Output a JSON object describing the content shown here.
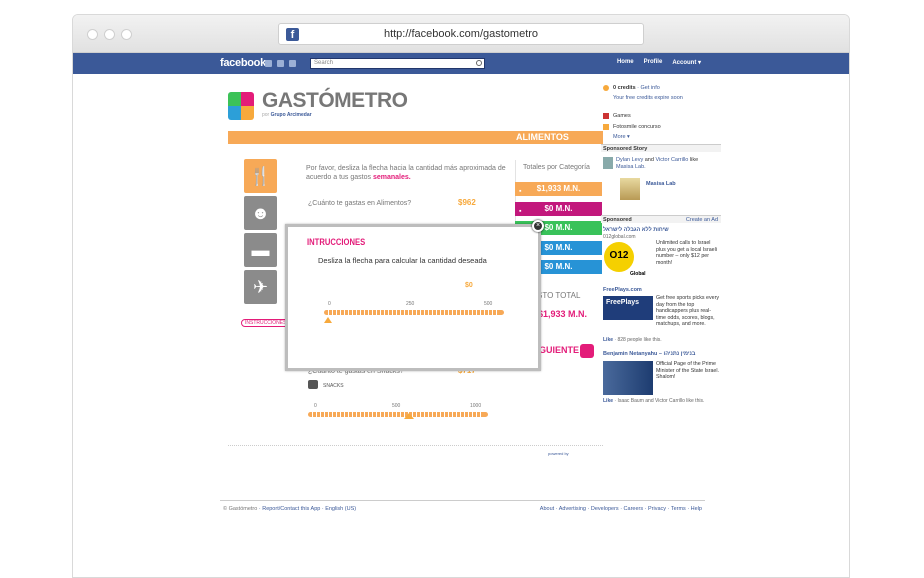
{
  "browser": {
    "url": "http://facebook.com/gastometro"
  },
  "fb": {
    "logo": "facebook",
    "search_placeholder": "Search",
    "nav": {
      "home": "Home",
      "profile": "Profile",
      "account": "Account ▾"
    }
  },
  "app": {
    "title": "GASTÓMETRO",
    "subtitle_prefix": "por",
    "subtitle_brand": "Grupo Arcimedar",
    "category": "ALIMENTOS",
    "description": "Por favor, desliza la flecha hacia la cantidad más aproximada de acuerdo a tus gastos",
    "description_bold": "semanales.",
    "instrucciones_link": "INSTRUCCIONES",
    "q1": "¿Cuánto te gastas en Alimentos?",
    "q1_amount": "$962",
    "q2": "¿Cuánto te gastas en Snacks?",
    "q2_amount": "$717",
    "snacks_label": "SNACKS",
    "snacks_ticks": [
      "0",
      "500",
      "1000"
    ],
    "snacks_value_fraction": 0.57,
    "totals_title": "Totales por Categoría",
    "totals": [
      {
        "value": "$1,933 M.N.",
        "color": "#f7a957"
      },
      {
        "value": "$0 M.N.",
        "color": "#c2187c"
      },
      {
        "value": "$0 M.N.",
        "color": "#39c25a"
      },
      {
        "value": "$0 M.N.",
        "color": "#2793d6"
      },
      {
        "value": "$0 M.N.",
        "color": "#2793d6"
      }
    ],
    "costo_label": "STO TOTAL",
    "costo_value": "$1,933 M.N.",
    "siguiente": "GUIENTE",
    "powered": "powered by"
  },
  "modal": {
    "title": "INTRUCCIONES",
    "text": "Desliza la flecha para calcular la cantidad deseada",
    "value": "$0",
    "ticks": [
      "0",
      "250",
      "500"
    ],
    "value_fraction": 0,
    "close": "×"
  },
  "footer": {
    "left": "© Gastómetro",
    "left_links": "· Report/Contact this App · English (US)",
    "right": "About · Advertising · Developers · Careers · Privacy · Terms · Help"
  },
  "sidebar": {
    "credits": "0 credits",
    "get_info": "· Get info",
    "free_credits": "Your free credits expire soon",
    "games": "Games",
    "fotosmile": "Fotosmile concurso",
    "more": "More ▾",
    "sponsored_story": "Sponsored Story",
    "story_text_a": "Dylan Levy",
    "story_text_b": " and ",
    "story_text_c": "Victor Carrillo",
    "story_text_d": " like",
    "story_page": "Masisa Lab.",
    "story_ad": "Masisa Lab",
    "sponsored": "Sponsored",
    "create_ad": "Create an Ad",
    "ad1_head": "שיחות ללא הגבלה לישראל",
    "ad1_site": "012global.com",
    "ad1_text": "Unlimited calls to Israel plus you get a local Israeli number – only $12 per month!",
    "ad1_logo": "O12",
    "ad1_logo2": "Global",
    "ad2_head": "FreePlays.com",
    "ad2_logo": "FreePlays",
    "ad2_text": "Get free sports picks every day from the top handicappers plus real-time odds, scores, blogs, matchups, and more.",
    "ad2_like": "· 828 people like this.",
    "ad3_head": "Benjamin Netanyahu – בנימין נתניהו",
    "ad3_text": "Official Page of the Prime Minister of the State Israel. Shalom!",
    "ad3_like": "· Isaac Baum and Victor Carrillo like this.",
    "like": "Like"
  }
}
